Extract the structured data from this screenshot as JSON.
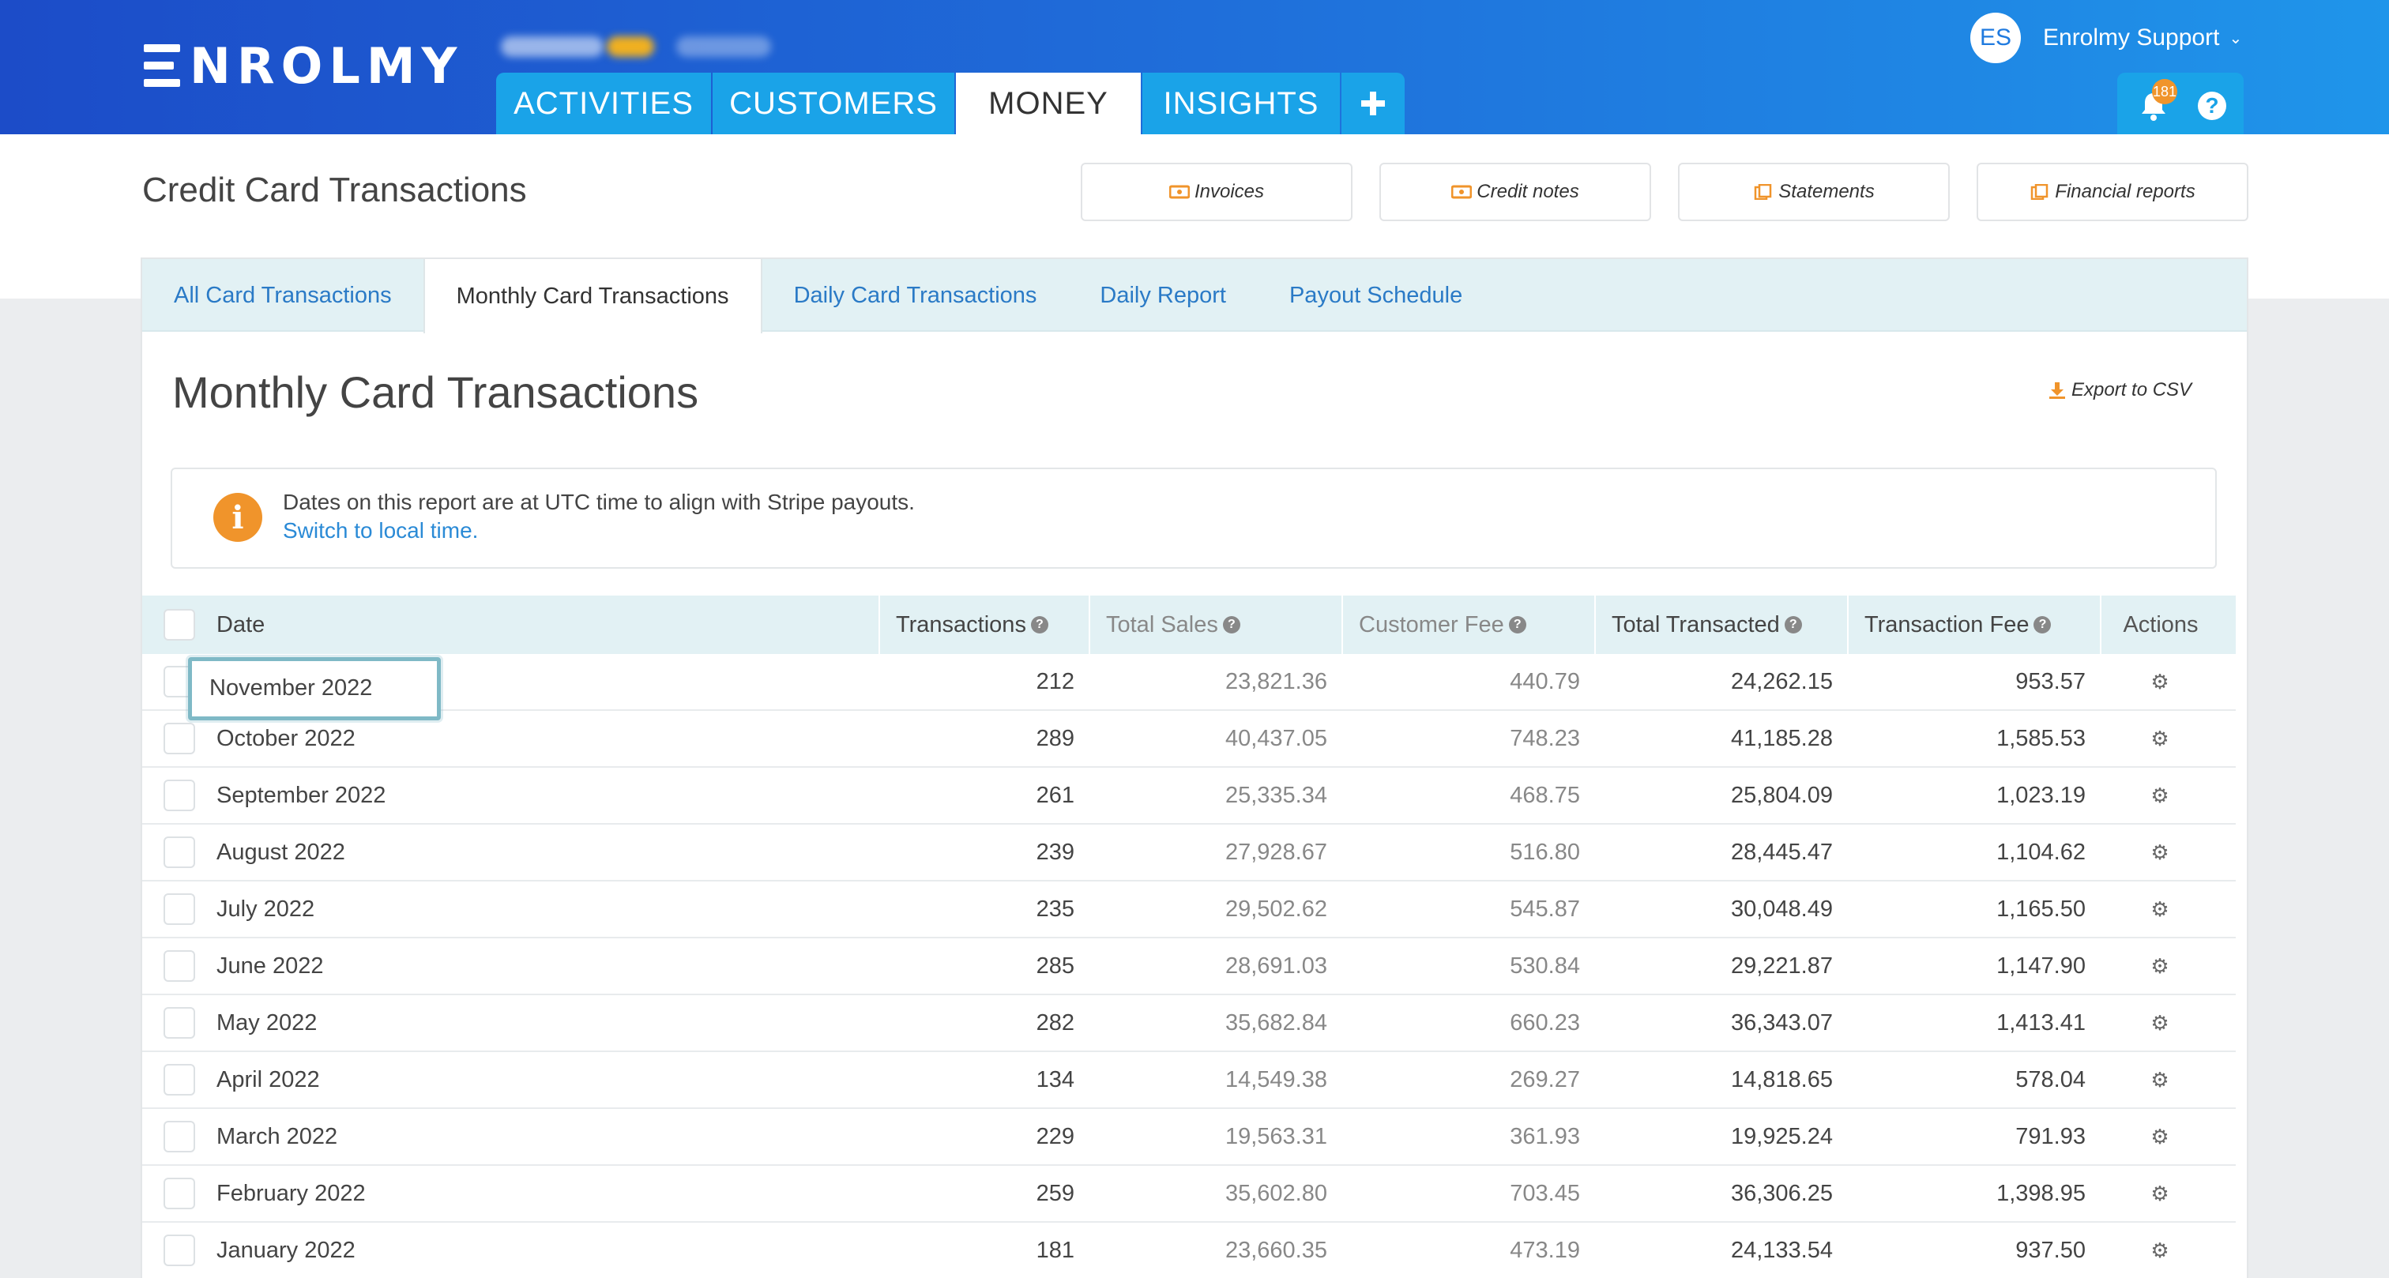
{
  "app": {
    "logo_text": "NROLMY",
    "nav_tabs": [
      "ACTIVITIES",
      "CUSTOMERS",
      "MONEY",
      "INSIGHTS"
    ],
    "active_tab": "MONEY",
    "plus_label": "+",
    "user": {
      "initials": "ES",
      "name": "Enrolmy Support"
    },
    "notifications_count": "181",
    "help_label": "?",
    "icons": [
      "bell-icon",
      "help-icon",
      "plus-icon",
      "chevron-down-icon"
    ]
  },
  "header": {
    "title": "Credit Card Transactions",
    "buttons": [
      {
        "label": "Invoices",
        "icon": "money-icon"
      },
      {
        "label": "Credit notes",
        "icon": "money-icon"
      },
      {
        "label": "Statements",
        "icon": "documents-icon"
      },
      {
        "label": "Financial reports",
        "icon": "documents-icon"
      }
    ]
  },
  "subtabs": [
    "All Card Transactions",
    "Monthly Card Transactions",
    "Daily Card Transactions",
    "Daily Report",
    "Payout Schedule"
  ],
  "active_subtab": "Monthly Card Transactions",
  "section": {
    "title": "Monthly Card Transactions",
    "export_label": "Export to CSV",
    "info_text": "Dates on this report are at UTC time to align with Stripe payouts.",
    "info_link": "Switch to local time."
  },
  "table": {
    "columns": [
      "Date",
      "Transactions",
      "Total Sales",
      "Customer Fee",
      "Total Transacted",
      "Transaction Fee",
      "Actions"
    ],
    "rows": [
      {
        "date": "November 2022",
        "transactions": "212",
        "total_sales": "23,821.36",
        "customer_fee": "440.79",
        "total_transacted": "24,262.15",
        "transaction_fee": "953.57"
      },
      {
        "date": "October 2022",
        "transactions": "289",
        "total_sales": "40,437.05",
        "customer_fee": "748.23",
        "total_transacted": "41,185.28",
        "transaction_fee": "1,585.53"
      },
      {
        "date": "September 2022",
        "transactions": "261",
        "total_sales": "25,335.34",
        "customer_fee": "468.75",
        "total_transacted": "25,804.09",
        "transaction_fee": "1,023.19"
      },
      {
        "date": "August 2022",
        "transactions": "239",
        "total_sales": "27,928.67",
        "customer_fee": "516.80",
        "total_transacted": "28,445.47",
        "transaction_fee": "1,104.62"
      },
      {
        "date": "July 2022",
        "transactions": "235",
        "total_sales": "29,502.62",
        "customer_fee": "545.87",
        "total_transacted": "30,048.49",
        "transaction_fee": "1,165.50"
      },
      {
        "date": "June 2022",
        "transactions": "285",
        "total_sales": "28,691.03",
        "customer_fee": "530.84",
        "total_transacted": "29,221.87",
        "transaction_fee": "1,147.90"
      },
      {
        "date": "May 2022",
        "transactions": "282",
        "total_sales": "35,682.84",
        "customer_fee": "660.23",
        "total_transacted": "36,343.07",
        "transaction_fee": "1,413.41"
      },
      {
        "date": "April 2022",
        "transactions": "134",
        "total_sales": "14,549.38",
        "customer_fee": "269.27",
        "total_transacted": "14,818.65",
        "transaction_fee": "578.04"
      },
      {
        "date": "March 2022",
        "transactions": "229",
        "total_sales": "19,563.31",
        "customer_fee": "361.93",
        "total_transacted": "19,925.24",
        "transaction_fee": "791.93"
      },
      {
        "date": "February 2022",
        "transactions": "259",
        "total_sales": "35,602.80",
        "customer_fee": "703.45",
        "total_transacted": "36,306.25",
        "transaction_fee": "1,398.95"
      },
      {
        "date": "January 2022",
        "transactions": "181",
        "total_sales": "23,660.35",
        "customer_fee": "473.19",
        "total_transacted": "24,133.54",
        "transaction_fee": "937.50"
      }
    ]
  },
  "colors": {
    "brand_blue": "#1f6ad8",
    "tab_blue": "#1aa3e8",
    "accent_orange": "#f0942b",
    "link_blue": "#2a7ac6",
    "highlight": "#7fb9c6"
  }
}
